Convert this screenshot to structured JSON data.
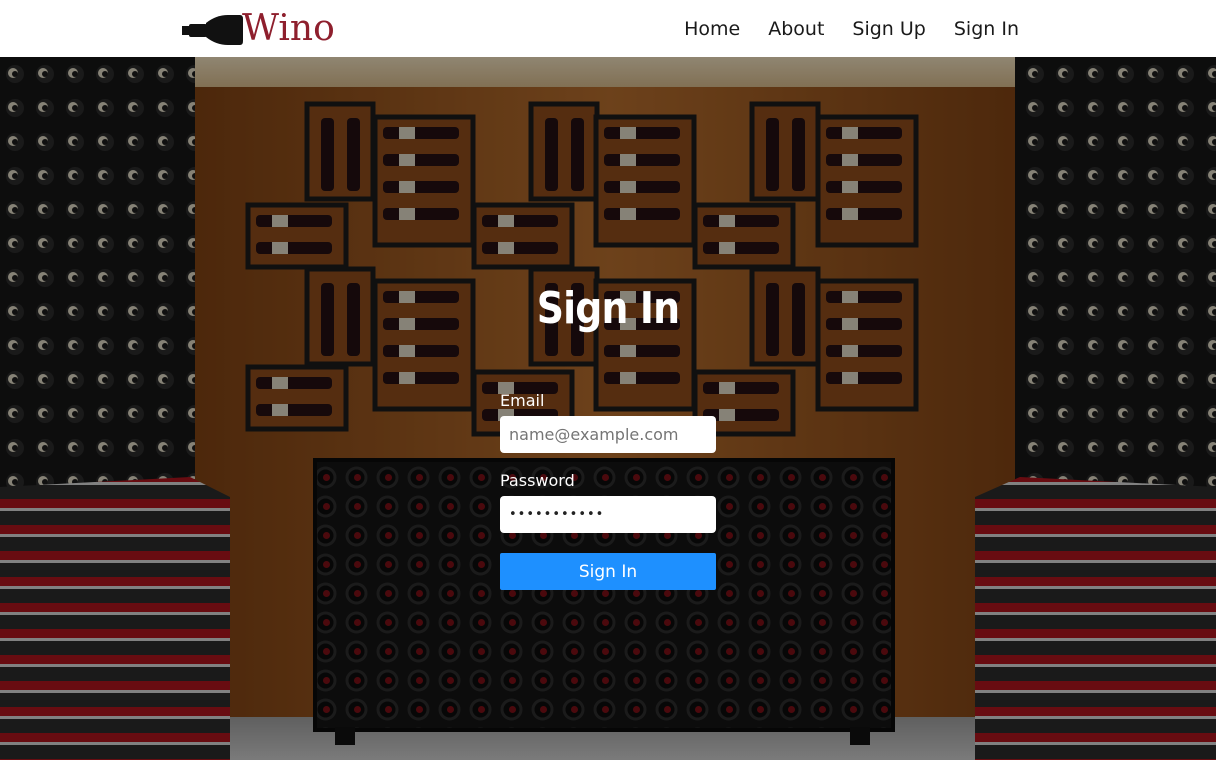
{
  "brand": {
    "name": "Wino",
    "logo_icon": "wine-bottle-icon",
    "color": "#8e1f2d"
  },
  "nav": {
    "items": [
      "Home",
      "About",
      "Sign Up",
      "Sign In"
    ]
  },
  "form": {
    "title": "Sign In",
    "email_label": "Email",
    "email_placeholder": "name@example.com",
    "password_label": "Password",
    "password_value": "•••••••••••",
    "submit_label": "Sign In",
    "submit_color": "#1e90ff"
  },
  "background": {
    "scene": "wine-cellar-background",
    "theme_colors": [
      "#a5622a",
      "#1a1a1a",
      "#b3202a"
    ]
  }
}
